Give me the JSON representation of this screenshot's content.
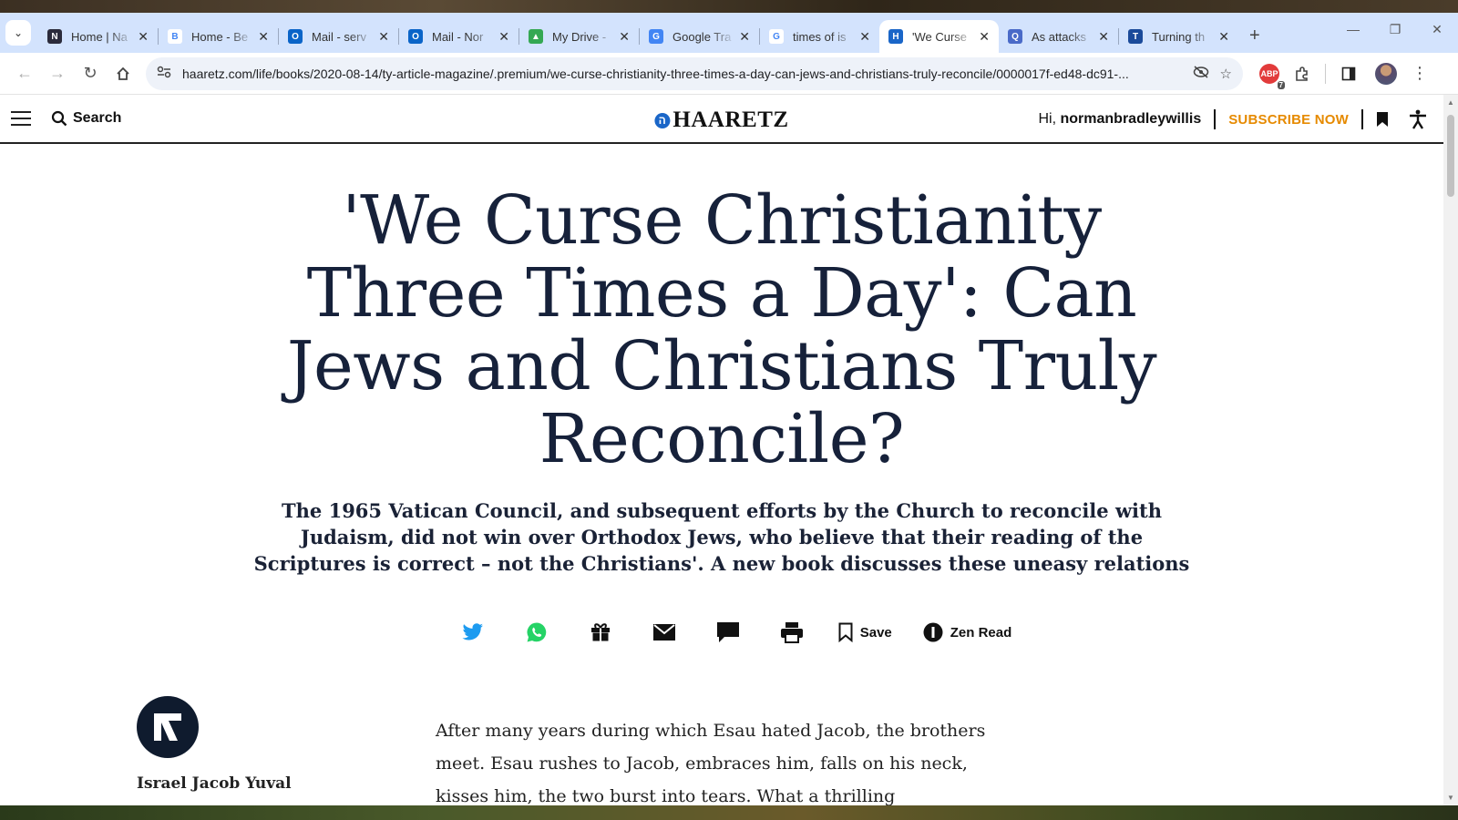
{
  "tabs": [
    {
      "title": "Home | Na",
      "fav_color": "#2b2b3b",
      "fav_glyph": "N"
    },
    {
      "title": "Home - Be",
      "fav_color": "#ffffff",
      "fav_glyph": "B"
    },
    {
      "title": "Mail - serv",
      "fav_color": "#0a64c8",
      "fav_glyph": "O"
    },
    {
      "title": "Mail - Nor",
      "fav_color": "#0a64c8",
      "fav_glyph": "O"
    },
    {
      "title": "My Drive -",
      "fav_color": "#34a853",
      "fav_glyph": "▲"
    },
    {
      "title": "Google Tra",
      "fav_color": "#4285f4",
      "fav_glyph": "G"
    },
    {
      "title": "times of is",
      "fav_color": "#ffffff",
      "fav_glyph": "G"
    },
    {
      "title": "'We Curse",
      "fav_color": "#1a66c8",
      "fav_glyph": "H",
      "active": true
    },
    {
      "title": "As attacks",
      "fav_color": "#4a6ac8",
      "fav_glyph": "Q"
    },
    {
      "title": "Turning th",
      "fav_color": "#1a4a9a",
      "fav_glyph": "T"
    }
  ],
  "toolbar": {
    "url": "haaretz.com/life/books/2020-08-14/ty-article-magazine/.premium/we-curse-christianity-three-times-a-day-can-jews-and-christians-truly-reconcile/0000017f-ed48-dc91-...",
    "abp_badge": "7",
    "abp_label": "ABP"
  },
  "site_header": {
    "search_label": "Search",
    "logo_text": "HAARETZ",
    "greeting_prefix": "Hi,",
    "username": "normanbradleywillis",
    "subscribe_label": "SUBSCRIBE NOW"
  },
  "article": {
    "headline": "'We Curse Christianity Three Times a Day': Can Jews and Christians Truly Reconcile?",
    "subhead": "The 1965 Vatican Council, and subsequent efforts by the Church to reconcile with Judaism, did not win over Orthodox Jews, who believe that their reading of the Scriptures is correct – not the Christians'. A new book discusses these uneasy relations",
    "share": {
      "save_label": "Save",
      "zen_label": "Zen Read"
    },
    "author_name": "Israel Jacob Yuval",
    "body_text": "After many years during which Esau hated Jacob, the brothers meet. Esau rushes to Jacob, embraces him, falls on his neck, kisses him, the two burst into tears. What a thrilling reconciliation. But the"
  },
  "colors": {
    "tabstrip": "#d3e3fd",
    "headline": "#16213a",
    "subscribe": "#e68a00",
    "logo_mark": "#1a66c8"
  }
}
